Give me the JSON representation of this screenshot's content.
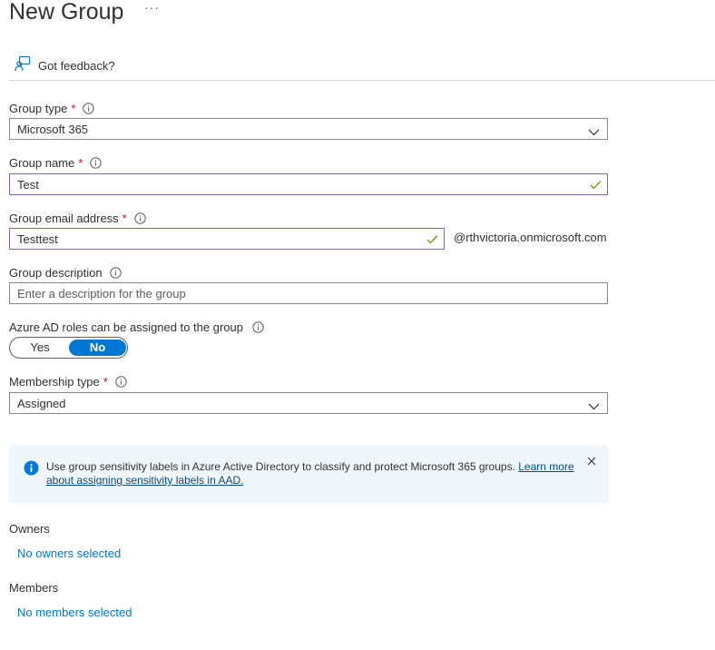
{
  "page": {
    "title": "New Group",
    "more_label": "···"
  },
  "feedback": {
    "label": "Got feedback?",
    "icon": "feedback-person-icon"
  },
  "form": {
    "group_type": {
      "label": "Group type",
      "required": "*",
      "value": "Microsoft 365"
    },
    "group_name": {
      "label": "Group name",
      "required": "*",
      "value": "Test"
    },
    "group_email": {
      "label": "Group email address",
      "required": "*",
      "value": "Testtest",
      "domain": "@rthvictoria.onmicrosoft.com"
    },
    "group_description": {
      "label": "Group description",
      "placeholder": "Enter a description for the group",
      "value": ""
    },
    "azure_ad_roles": {
      "label": "Azure AD roles can be assigned to the group",
      "yes": "Yes",
      "no": "No",
      "selected": "No"
    },
    "membership_type": {
      "label": "Membership type",
      "required": "*",
      "value": "Assigned"
    }
  },
  "banner": {
    "text": "Use group sensitivity labels in Azure Active Directory to classify and protect Microsoft 365 groups.",
    "link": "Learn more about assigning sensitivity labels in AAD."
  },
  "owners": {
    "label": "Owners",
    "link": "No owners selected"
  },
  "members": {
    "label": "Members",
    "link": "No members selected"
  },
  "colors": {
    "accent": "#0078d4",
    "required": "#c50f1f",
    "valid_border": "#8764b8",
    "check": "#57a300",
    "banner_bg": "#eff6fc"
  }
}
